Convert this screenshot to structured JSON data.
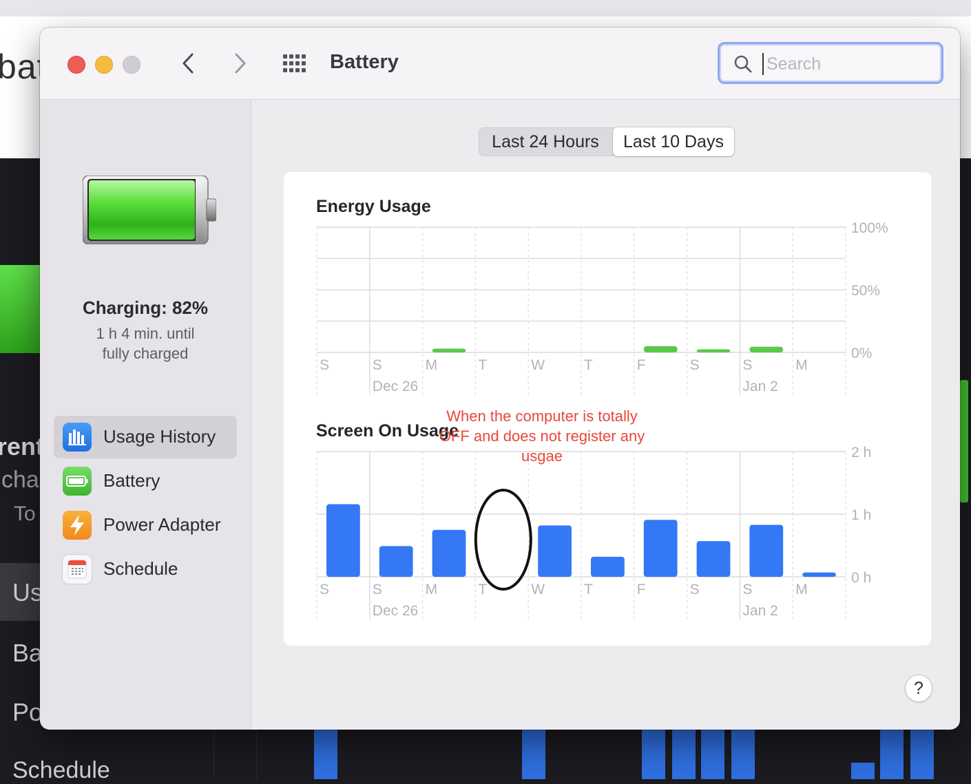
{
  "background": {
    "search_fragment": "bat",
    "fragments": [
      "rent",
      "cha",
      "To",
      "Us",
      "Ba",
      "Po",
      "Schedule"
    ]
  },
  "window": {
    "title": "Battery",
    "search": {
      "placeholder": "Search",
      "value": ""
    }
  },
  "sidebar": {
    "status_title": "Charging: 82%",
    "status_line1": "1 h 4 min. until",
    "status_line2": "fully charged",
    "charge_level": 0.82,
    "items": [
      {
        "label": "Usage History",
        "icon": "bar-chart-icon",
        "selected": true
      },
      {
        "label": "Battery",
        "icon": "battery-icon",
        "selected": false
      },
      {
        "label": "Power Adapter",
        "icon": "lightning-bolt-icon",
        "selected": false
      },
      {
        "label": "Schedule",
        "icon": "calendar-icon",
        "selected": false
      }
    ]
  },
  "segmented": {
    "options": [
      "Last 24 Hours",
      "Last 10 Days"
    ],
    "selected": "Last 10 Days"
  },
  "annotation": "When the computer is totally OFF and does not register any usgae",
  "help_label": "?",
  "colors": {
    "energy_bar": "#5ac84a",
    "screen_bar": "#3478f6",
    "annotation": "#e8483a"
  },
  "chart_data": [
    {
      "type": "bar",
      "title": "Energy Usage",
      "categories": [
        "S",
        "S",
        "M",
        "T",
        "W",
        "T",
        "F",
        "S",
        "S",
        "M"
      ],
      "date_labels": [
        {
          "index": 1,
          "label": "Dec 26"
        },
        {
          "index": 8,
          "label": "Jan 2"
        }
      ],
      "y_ticks": [
        "100%",
        "50%",
        "0%"
      ],
      "ylim": [
        0,
        100
      ],
      "unit": "%",
      "values": [
        0,
        0,
        3,
        0,
        0,
        0,
        5,
        2.5,
        4.5,
        0
      ],
      "grid": true
    },
    {
      "type": "bar",
      "title": "Screen On Usage",
      "categories": [
        "S",
        "S",
        "M",
        "T",
        "W",
        "T",
        "F",
        "S",
        "S",
        "M"
      ],
      "date_labels": [
        {
          "index": 1,
          "label": "Dec 26"
        },
        {
          "index": 8,
          "label": "Jan 2"
        }
      ],
      "y_ticks": [
        "2 h",
        "1 h",
        "0 h"
      ],
      "ylim": [
        0,
        2
      ],
      "unit": "h",
      "values": [
        1.16,
        0.49,
        0.75,
        0,
        0.82,
        0.32,
        0.91,
        0.57,
        0.83,
        0.07
      ],
      "grid": true,
      "highlighted_index": 3
    }
  ]
}
